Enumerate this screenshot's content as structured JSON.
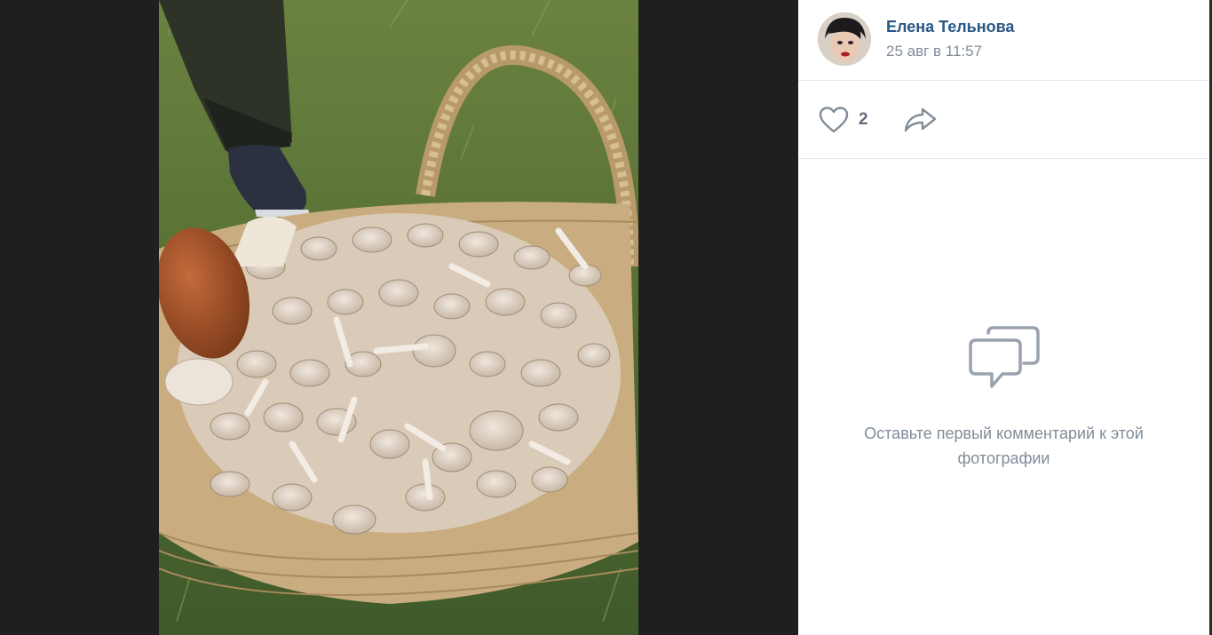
{
  "post": {
    "author_name": "Елена Тельнова",
    "date": "25 авг в 11:57",
    "likes": "2"
  },
  "comments": {
    "empty_line1": "Оставьте первый комментарий к этой",
    "empty_line2": "фотографии"
  },
  "icons": {
    "like": "heart-icon",
    "share": "share-arrow-icon",
    "comments": "comment-bubbles-icon"
  },
  "colors": {
    "link": "#2a5885",
    "muted": "#818c99",
    "background_dark": "#1f1f1f"
  }
}
